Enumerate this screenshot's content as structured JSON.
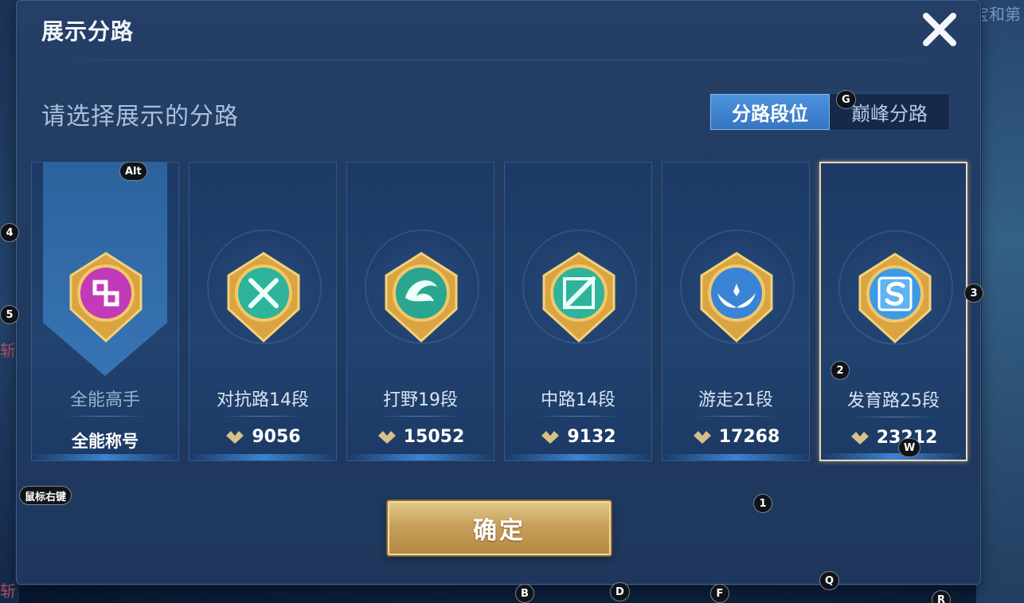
{
  "background": {
    "top_right_text": "宝和第",
    "left_glyphs": [
      "斩",
      "斩"
    ]
  },
  "dialog": {
    "title": "展示分路",
    "close_icon": "close-icon",
    "subtitle": "请选择展示的分路",
    "tabs": [
      {
        "label": "分路段位",
        "active": true
      },
      {
        "label": "巅峰分路",
        "active": false
      }
    ],
    "confirm_label": "确定"
  },
  "cards": [
    {
      "role": "全能高手",
      "title_label": "全能称号",
      "icon": "all-round-emblem-icon",
      "color": "#c23ab8",
      "selected": false
    },
    {
      "role": "对抗路14段",
      "score": "9056",
      "icon": "clash-lane-emblem-icon",
      "color": "#2fb39a",
      "selected": false
    },
    {
      "role": "打野19段",
      "score": "15052",
      "icon": "jungle-dragon-emblem-icon",
      "color": "#2aa590",
      "selected": false
    },
    {
      "role": "中路14段",
      "score": "9132",
      "icon": "mid-lane-emblem-icon",
      "color": "#2fb39a",
      "selected": false
    },
    {
      "role": "游走21段",
      "score": "17268",
      "icon": "roam-wings-emblem-icon",
      "color": "#3a84d6",
      "selected": false
    },
    {
      "role": "发育路25段",
      "score": "23212",
      "icon": "farm-lane-emblem-icon",
      "color": "#3b9ae6",
      "selected": true
    }
  ],
  "key_hints": {
    "alt": "Alt",
    "g": "G",
    "k4": "4",
    "k5": "5",
    "k3": "3",
    "k2": "2",
    "w": "W",
    "k1": "1",
    "right_click": "鼠标右键",
    "b": "B",
    "d": "D",
    "f": "F",
    "q": "Q",
    "r": "R"
  },
  "colors": {
    "accent_blue": "#3574c2",
    "gold": "#c7a05a",
    "selected_border": "#f4d7b0"
  }
}
